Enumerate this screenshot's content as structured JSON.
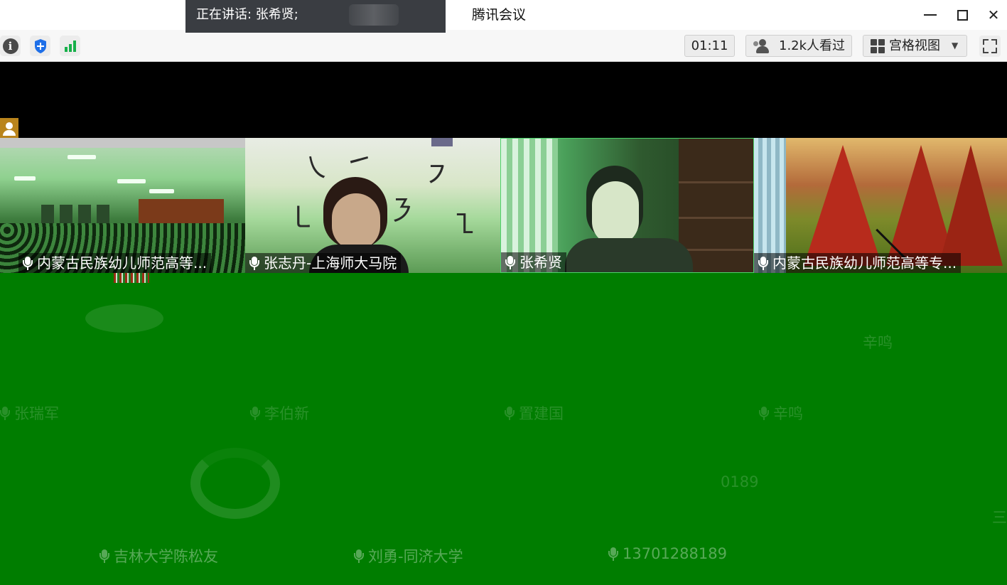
{
  "titlebar": {
    "speaking_text": "正在讲话: 张希贤;",
    "app_title": "腾讯会议"
  },
  "toolbar": {
    "timer": "01:11",
    "viewers": "1.2k人看过",
    "view_mode": "宫格视图",
    "signal_color": "#17b04a",
    "shield_color": "#1e6fe8"
  },
  "tiles": [
    {
      "name": "内蒙古民族幼儿师范高等..."
    },
    {
      "name": "张志丹-上海师大马院"
    },
    {
      "name": "张希贤"
    },
    {
      "name": "内蒙古民族幼儿师范高等专..."
    }
  ],
  "participants": {
    "row1_center_name": "辛鸣",
    "row2": [
      "张瑞军",
      "李伯新",
      "置建国",
      "辛鸣"
    ],
    "row3_number": "0189",
    "row3_char": "三",
    "row4": [
      "吉林大学陈松友",
      "刘勇-同济大学",
      "13701288189"
    ]
  },
  "colors": {
    "background": "#007d00",
    "speaking_bg": "#3a3d42"
  }
}
